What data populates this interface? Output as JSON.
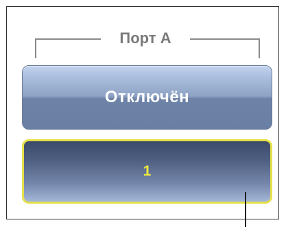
{
  "port": {
    "title": "Порт A",
    "status_label": "Отключён",
    "value_label": "1"
  },
  "colors": {
    "title_text": "#7a7a7a",
    "status_text": "#ffffff",
    "value_text": "#f0ea3a",
    "value_border": "#e6e04a"
  }
}
